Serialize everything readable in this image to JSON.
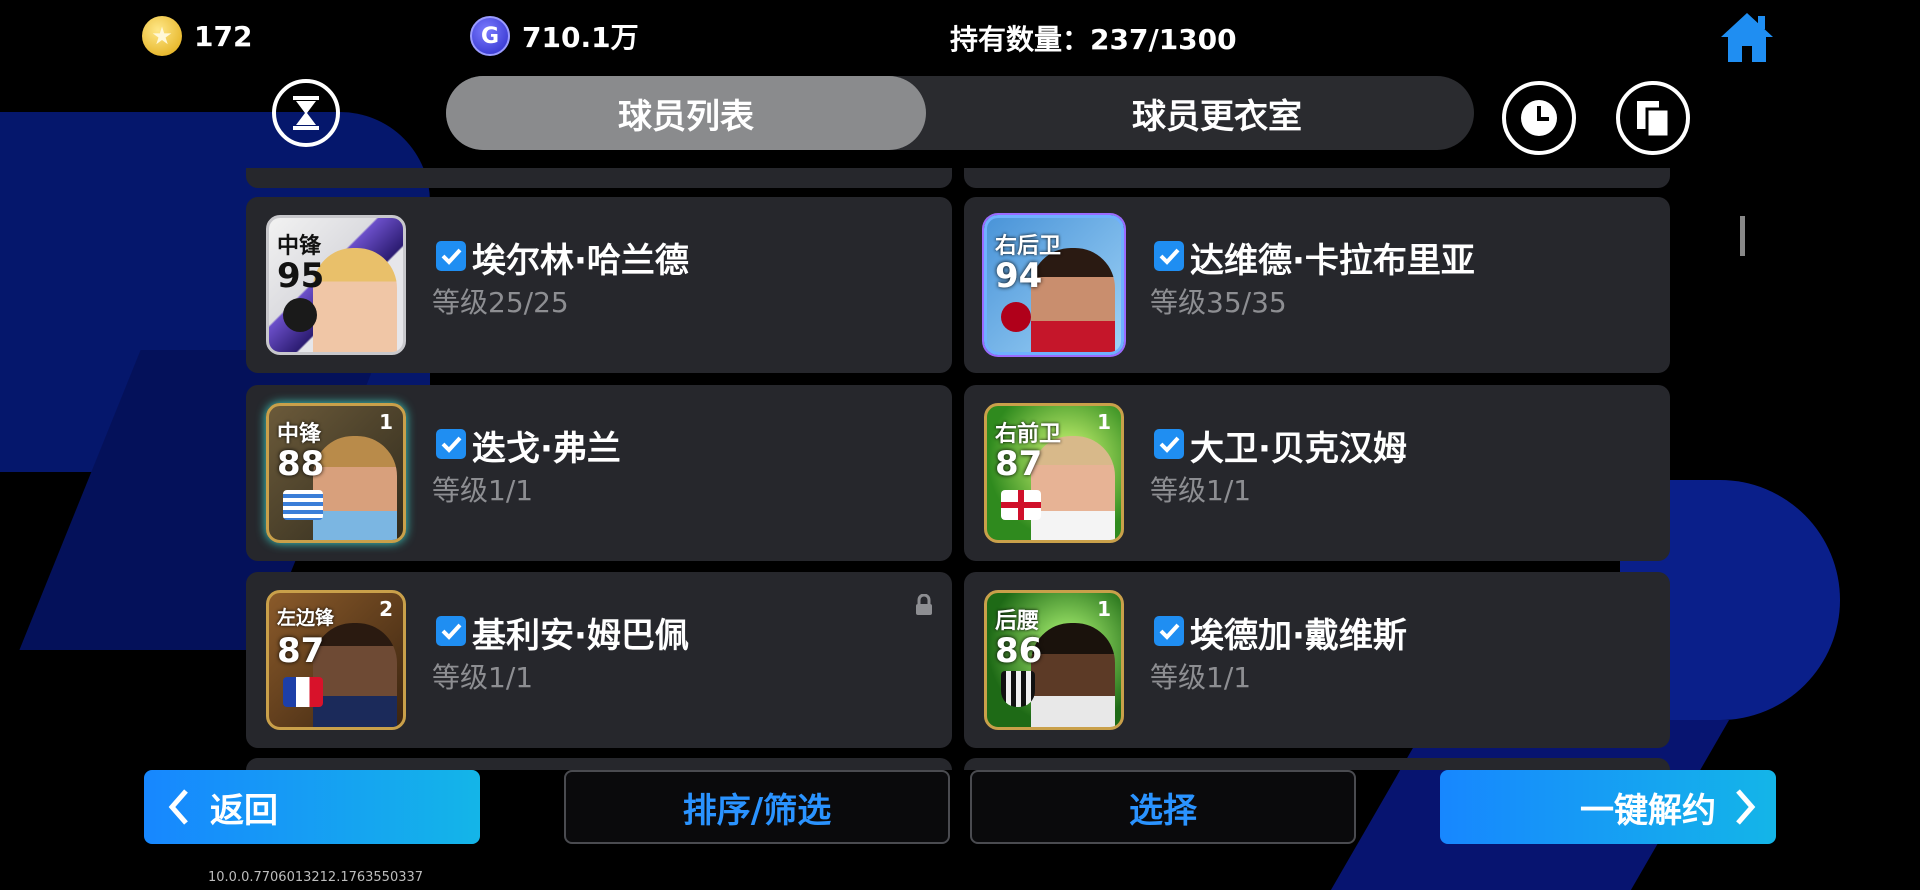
{
  "topbar": {
    "coins": "172",
    "gp": "710.1万",
    "holding_label": "持有数量：",
    "holding_value": "237/1300"
  },
  "tabs": [
    {
      "label": "球员列表",
      "active": true
    },
    {
      "label": "球员更衣室",
      "active": false
    }
  ],
  "icons": {
    "left": "hourglass-icon",
    "right1": "clock-icon",
    "right2": "copy-icon",
    "home": "home-icon"
  },
  "players": [
    {
      "position": "中锋",
      "rating": "95",
      "card_level": "",
      "name": "埃尔林·哈兰德",
      "level": "等级25/25",
      "checked": true,
      "locked": false
    },
    {
      "position": "右后卫",
      "rating": "94",
      "card_level": "",
      "name": "达维德·卡拉布里亚",
      "level": "等级35/35",
      "checked": true,
      "locked": false
    },
    {
      "position": "中锋",
      "rating": "88",
      "card_level": "1",
      "name": "迭戈·弗兰",
      "level": "等级1/1",
      "checked": true,
      "locked": false
    },
    {
      "position": "右前卫",
      "rating": "87",
      "card_level": "1",
      "name": "大卫·贝克汉姆",
      "level": "等级1/1",
      "checked": true,
      "locked": false
    },
    {
      "position": "左边锋",
      "rating": "87",
      "card_level": "2",
      "name": "基利安·姆巴佩",
      "level": "等级1/1",
      "checked": true,
      "locked": true
    },
    {
      "position": "后腰",
      "rating": "86",
      "card_level": "1",
      "name": "埃德加·戴维斯",
      "level": "等级1/1",
      "checked": true,
      "locked": false
    }
  ],
  "bottom": {
    "back": "返回",
    "sort_filter": "排序/筛选",
    "select": "选择",
    "release_all": "一键解约"
  },
  "version": "10.0.0.7706013212.1763550337",
  "colors": {
    "accent": "#1f8ef2",
    "card_bg": "#26272c",
    "button_gradient_start": "#1787ff",
    "button_gradient_end": "#14b5e8"
  }
}
